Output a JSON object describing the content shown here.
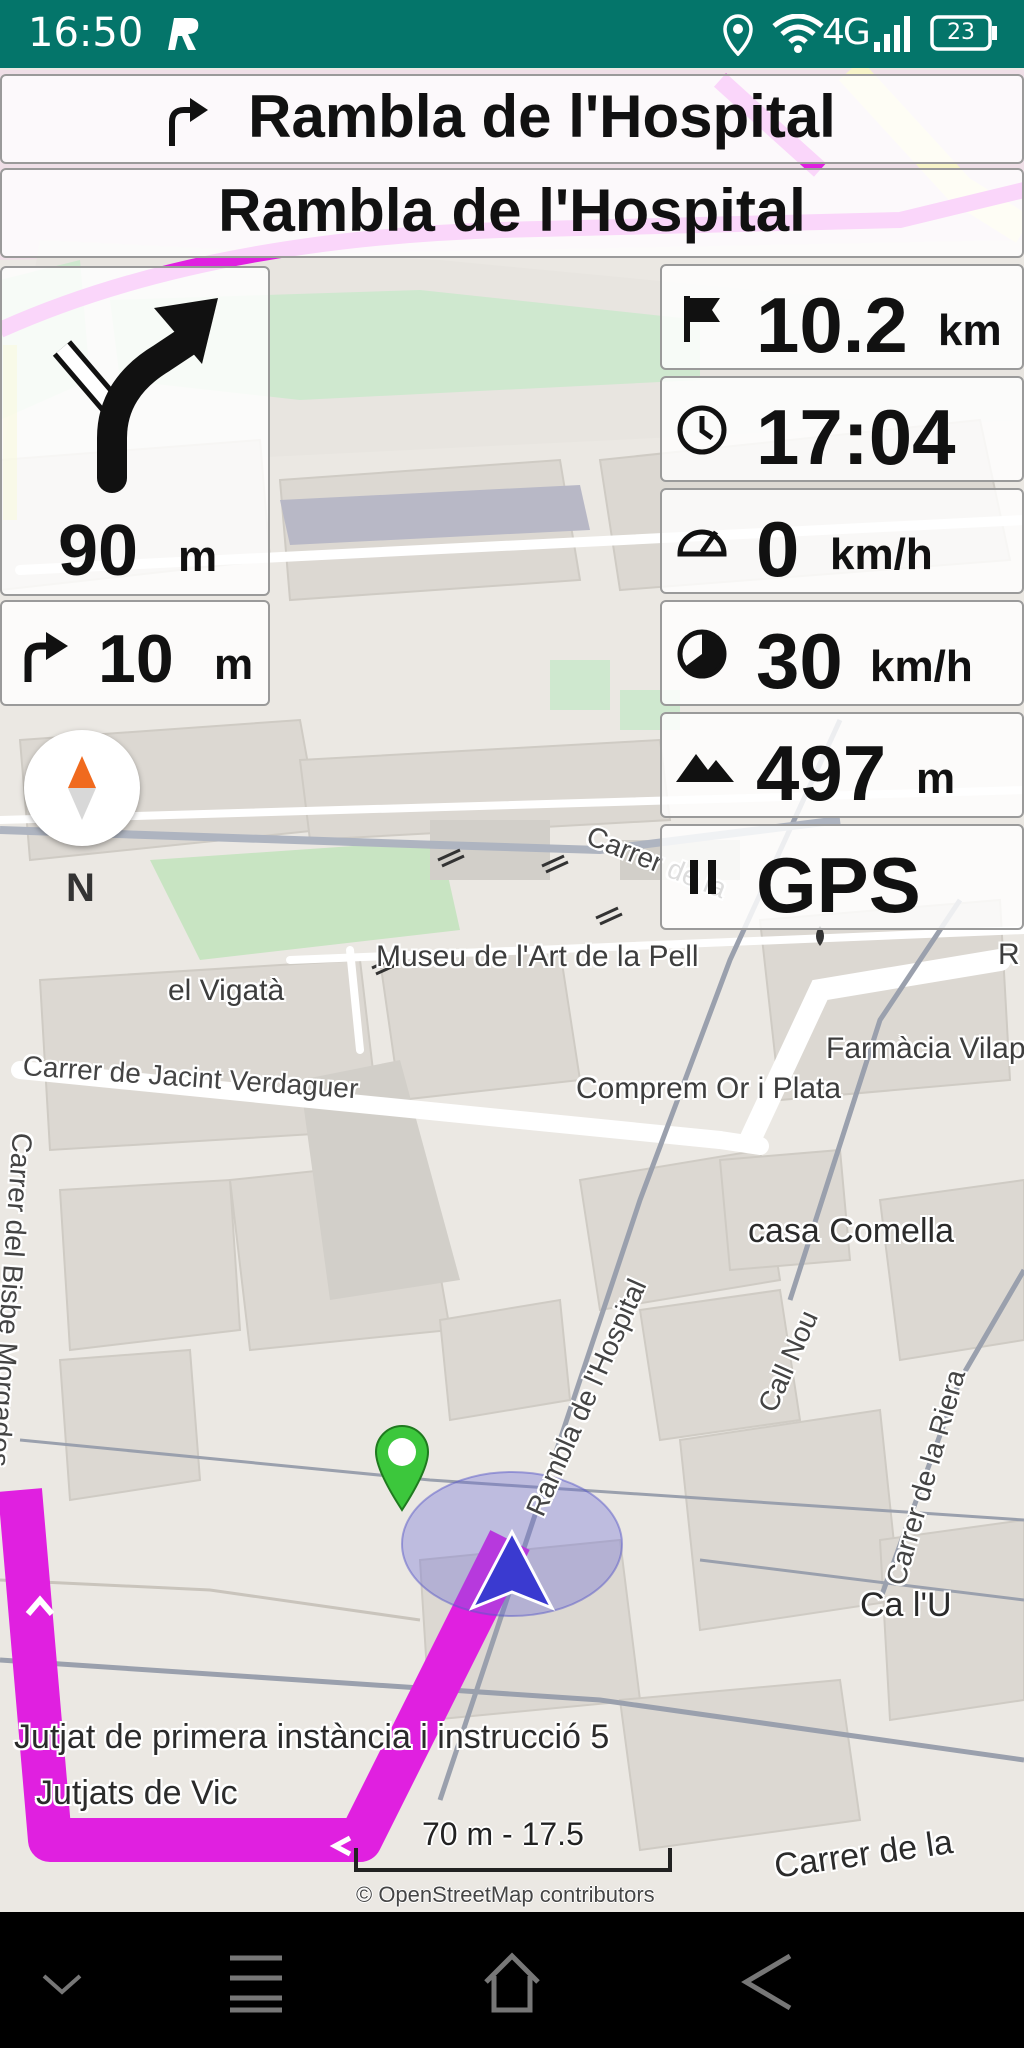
{
  "status_bar": {
    "time": "16:50",
    "network": "4G",
    "battery": "23"
  },
  "navigation": {
    "current_street": "Rambla de l'Hospital",
    "next_street": "Rambla de l'Hospital",
    "next_turn_distance": "90",
    "next_turn_unit": "m",
    "then_turn_distance": "10",
    "then_turn_unit": "m"
  },
  "info_widgets": {
    "distance_value": "10.2",
    "distance_unit": "km",
    "arrival_time": "17:04",
    "speed_value": "0",
    "speed_unit": "km/h",
    "max_speed_value": "30",
    "max_speed_unit": "km/h",
    "altitude_value": "497",
    "altitude_unit": "m",
    "gps_label": "GPS"
  },
  "compass": {
    "label": "N"
  },
  "map": {
    "labels": {
      "carrer_de_la": "Carrer de la",
      "museu": "Museu de l'Art de la Pell",
      "vigata": "el Vigatà",
      "farmacia": "Farmàcia Vilapl",
      "jacint": "Carrer de Jacint Verdaguer",
      "comprem": "Comprem Or i Plata",
      "casa_comella": "casa Comella",
      "bisbe": "Carrer del Bisbe Morgades",
      "rambla": "Rambla de l'Hospital",
      "call_nou": "Call Nou",
      "riera": "Carrer de la Riera",
      "ca_lu": "Ca l'U",
      "jutjat": "Jutjat de primera instància i instrucció 5",
      "jutjats": "Jutjats de Vic",
      "carrer_de_la_bottom": "Carrer de la",
      "r_edge": "R"
    },
    "scale": "70 m - 17.5",
    "attribution": "© OpenStreetMap contributors"
  },
  "colors": {
    "status_bar": "#04756a",
    "route": "#e020e0",
    "position_marker": "#3a3ad0",
    "destination_pin": "#3cc73c"
  }
}
